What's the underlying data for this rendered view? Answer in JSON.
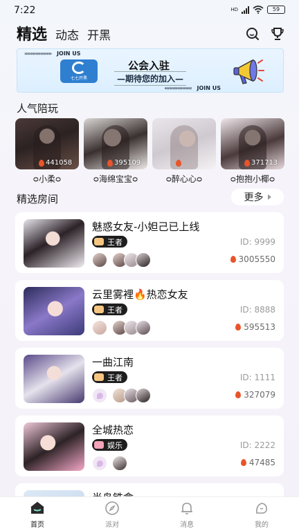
{
  "status_bar": {
    "time": "7:22",
    "network": "HD",
    "battery": "59"
  },
  "header": {
    "tabs": [
      {
        "label": "精选",
        "active": true
      },
      {
        "label": "动态",
        "active": false
      },
      {
        "label": "开黑",
        "active": false
      }
    ],
    "icons": [
      "search-icon",
      "trophy-icon"
    ]
  },
  "banner": {
    "strip_top": "JOIN US",
    "strip_bottom": "JOIN US",
    "logo_text": "七七开黑",
    "title": "公会入驻",
    "subtitle": "—期待您的加入—"
  },
  "popular": {
    "title": "人气陪玩",
    "players": [
      {
        "name": "ᴑ小柔ᴑ",
        "count": "441058"
      },
      {
        "name": "ᴑ海绵宝宝ᴑ",
        "count": "395109"
      },
      {
        "name": "ᴑ醉心心ᴑ",
        "count": ""
      },
      {
        "name": "ᴑ抱抱小椰ᴑ",
        "count": "371713"
      }
    ]
  },
  "rooms": {
    "title": "精选房间",
    "more_label": "更多",
    "items": [
      {
        "title": "魅惑女友-小妲己已上线",
        "tag": "王者",
        "id_text": "ID: 9999",
        "heat": "3005550",
        "avatars": 4
      },
      {
        "title": "云里雾裡🔥热恋女友",
        "tag": "王者",
        "id_text": "ID: 8888",
        "heat": "595513",
        "avatars": 4
      },
      {
        "title": "一曲江南",
        "tag": "王者",
        "id_text": "ID: 1111",
        "heat": "327079",
        "avatars": 4
      },
      {
        "title": "全城热恋",
        "tag": "娱乐",
        "id_text": "ID: 2222",
        "heat": "47485",
        "avatars": 2
      },
      {
        "title": "半岛铁盒",
        "tag": "",
        "id_text": "",
        "heat": "",
        "avatars": 0
      }
    ]
  },
  "bottom_nav": [
    {
      "label": "首页",
      "icon": "home-icon",
      "active": true
    },
    {
      "label": "派对",
      "icon": "compass-icon",
      "active": false
    },
    {
      "label": "消息",
      "icon": "bell-icon",
      "active": false
    },
    {
      "label": "我的",
      "icon": "profile-icon",
      "active": false
    }
  ],
  "colors": {
    "accent": "#1e1e1e",
    "fire": "#e8552a",
    "background": "#f4f3f9"
  }
}
